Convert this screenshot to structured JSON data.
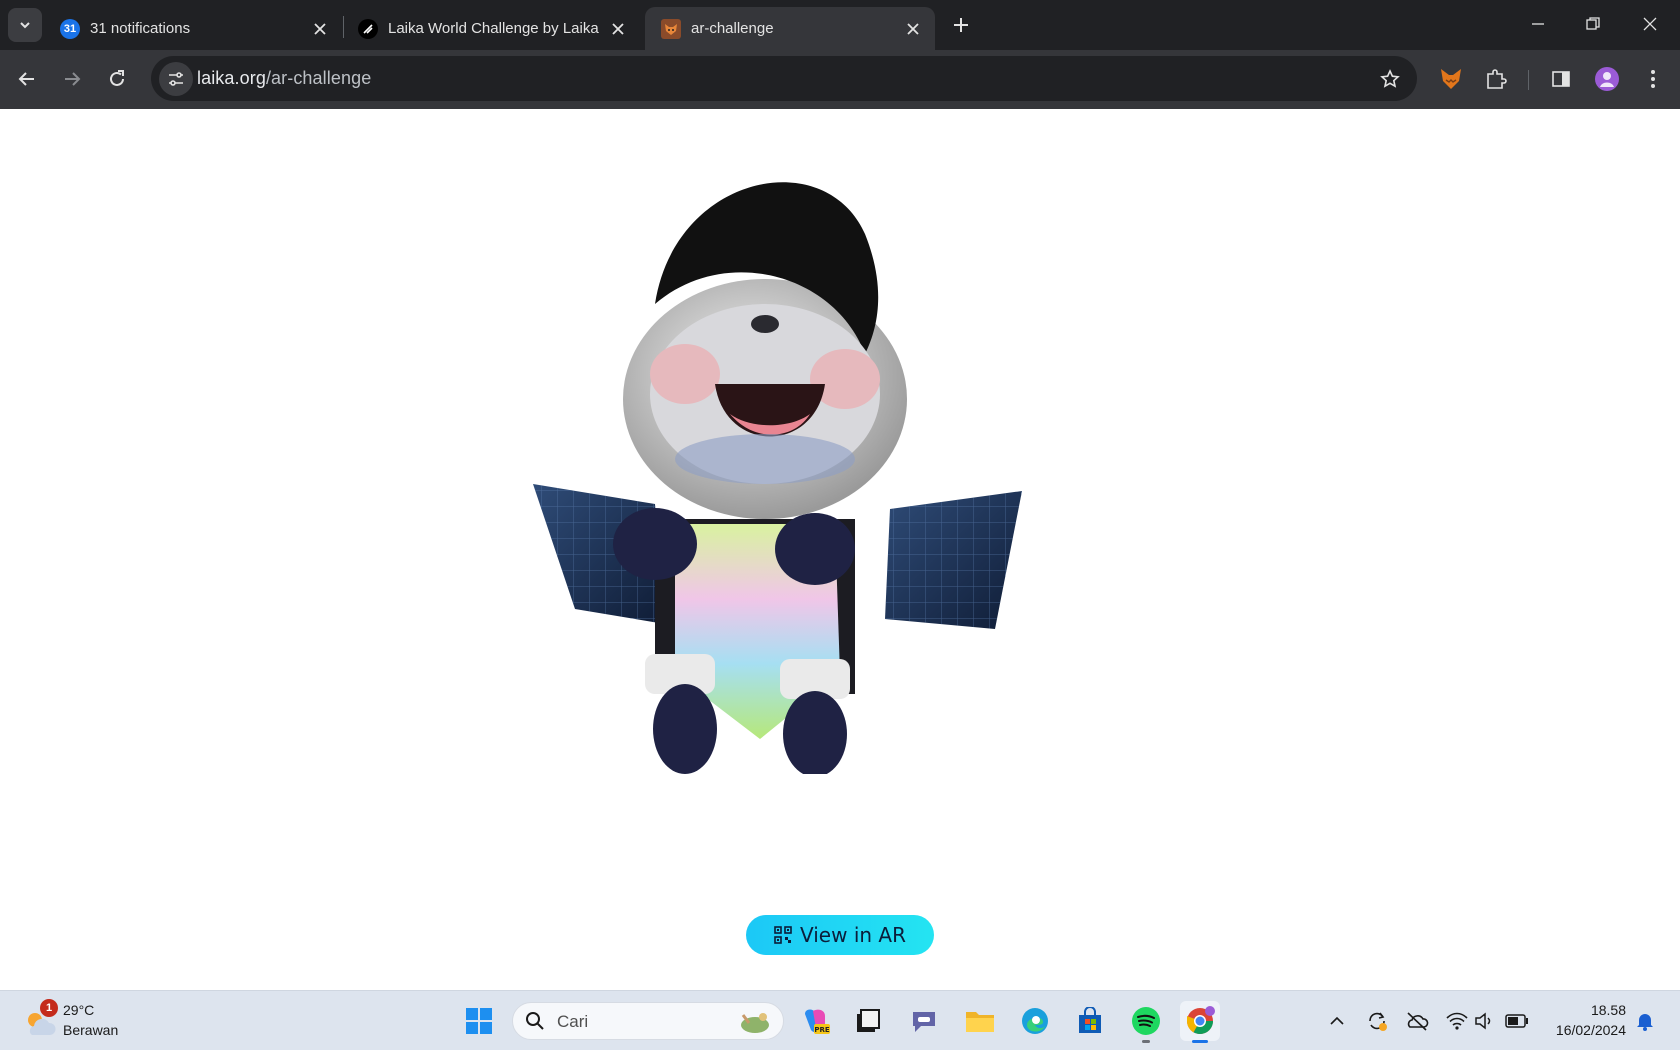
{
  "browser": {
    "tabs": [
      {
        "title": "31 notifications",
        "favicon_text": "31",
        "active": false
      },
      {
        "title": "Laika World Challenge by Laika",
        "favicon_text": "",
        "active": false
      },
      {
        "title": "ar-challenge",
        "favicon_text": "",
        "active": true
      }
    ],
    "url": {
      "host": "laika.org",
      "path": "/ar-challenge"
    }
  },
  "page": {
    "ar_button_label": "View in AR"
  },
  "taskbar": {
    "weather": {
      "temp": "29°C",
      "condition": "Berawan",
      "badge": "1"
    },
    "search_placeholder": "Cari",
    "clock": {
      "time": "18.58",
      "date": "16/02/2024"
    }
  },
  "colors": {
    "ar_button": "#1cc8f6",
    "tabbar_bg": "#202124",
    "toolbar_bg": "#35363a",
    "taskbar_bg": "#dde4ee"
  }
}
